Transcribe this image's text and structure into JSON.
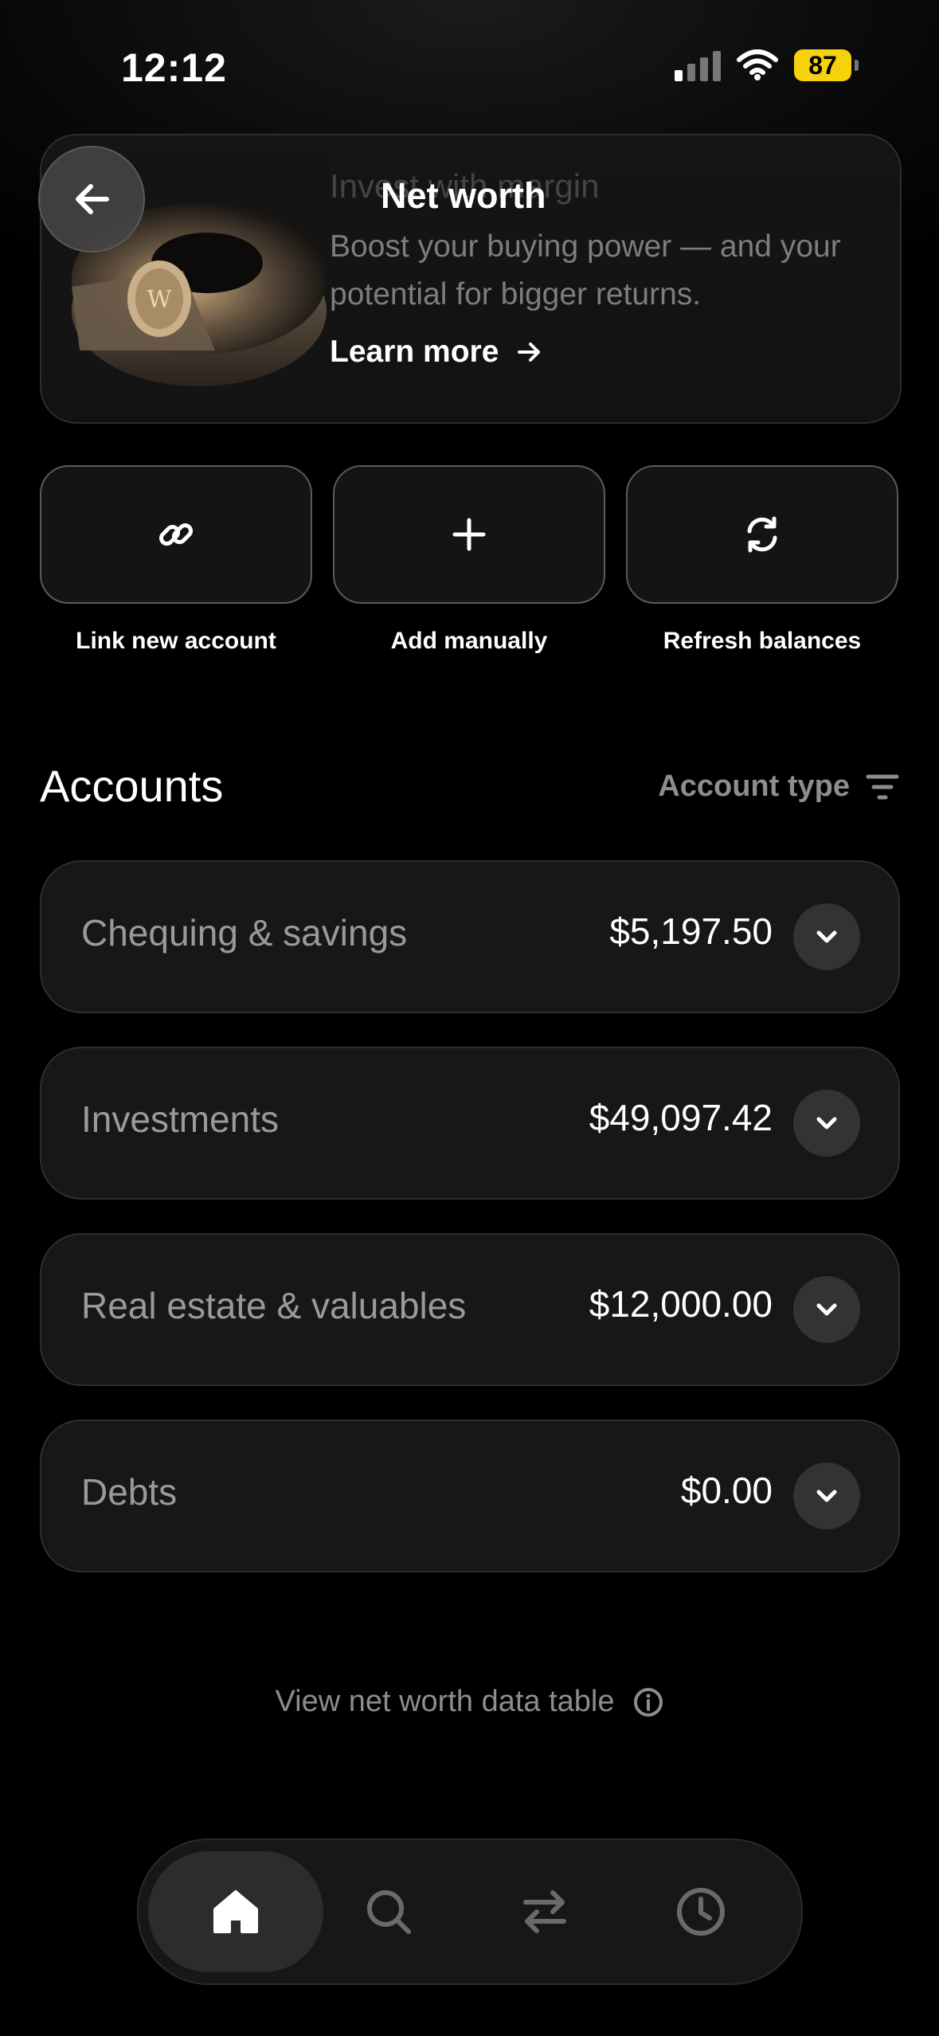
{
  "status_bar": {
    "time": "12:12",
    "battery": "87"
  },
  "header": {
    "title": "Net worth"
  },
  "promo": {
    "faded_title": "Invest with margin",
    "body": "Boost your buying power — and your potential for bigger returns.",
    "learn_more": "Learn more"
  },
  "actions": [
    {
      "label": "Link new account",
      "icon": "link-icon"
    },
    {
      "label": "Add manually",
      "icon": "plus-icon"
    },
    {
      "label": "Refresh balances",
      "icon": "refresh-icon"
    }
  ],
  "accounts": {
    "title": "Accounts",
    "sort_label": "Account type",
    "items": [
      {
        "name": "Chequing & savings",
        "amount": "$5,197.50"
      },
      {
        "name": "Investments",
        "amount": "$49,097.42"
      },
      {
        "name": "Real estate & valuables",
        "amount": "$12,000.00"
      },
      {
        "name": "Debts",
        "amount": "$0.00"
      }
    ]
  },
  "footer": {
    "view_table": "View net worth data table"
  },
  "tabbar": {
    "items": [
      "home-icon",
      "search-icon",
      "transfer-icon",
      "history-icon"
    ],
    "active": 0
  }
}
